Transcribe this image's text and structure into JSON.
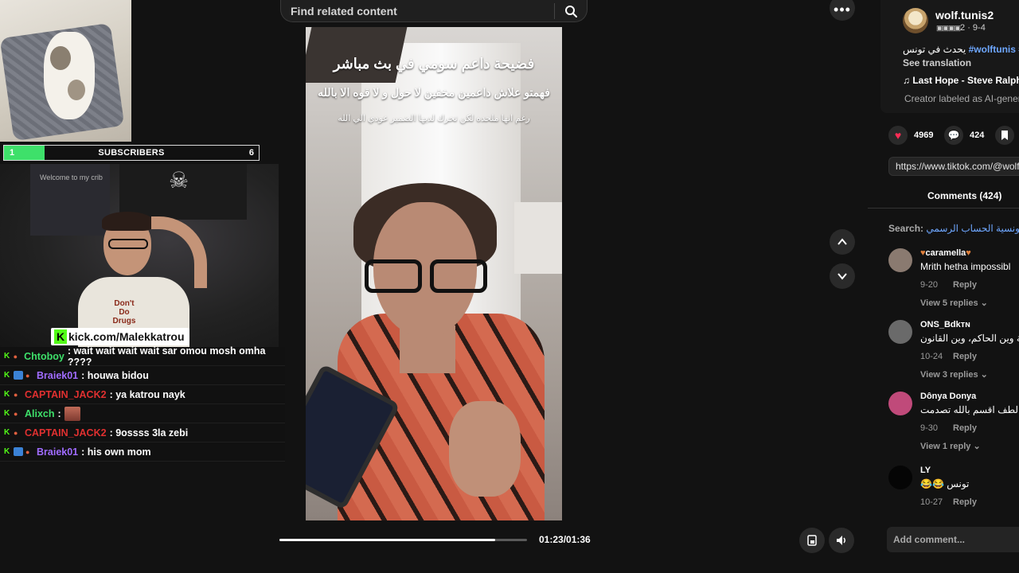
{
  "overlay": {
    "subscribers_label": "SUBSCRIBERS",
    "subscribers_current": "1",
    "subscribers_goal": "6",
    "subscribers_progress": 0.16,
    "cam_welcome": "Welcome to my crib",
    "shirt_text": "Don't Do Drugs",
    "kick_url": "kick.com/Malekkatrou"
  },
  "chat": [
    {
      "user": "Chtoboy",
      "message": ": wait wait wait wait sar omou mosh omha ????",
      "color": "#3ee06a"
    },
    {
      "user": "Braiek01",
      "message": ": houwa bidou",
      "color": "#a06cff"
    },
    {
      "user": "CAPTAIN_JACK2",
      "message": ": ya katrou nayk",
      "color": "#e03030"
    },
    {
      "user": "Alixch",
      "message": ":",
      "color": "#3ee06a",
      "emote": true
    },
    {
      "user": "CAPTAIN_JACK2",
      "message": ": 9ossss 3la zebi",
      "color": "#e03030"
    },
    {
      "user": "Braiek01",
      "message": ": his own mom",
      "color": "#a06cff"
    }
  ],
  "player": {
    "search_placeholder": "Find related content",
    "caption_1": "فضيحة داعم سومي في بث مباشر",
    "caption_2": "فهمتو علاش داعمين مخفين لا حول و لا قوه الا بالله",
    "caption_3": "رغم انها ملحده لكن تحرك لديها الضمير عودي الي الله",
    "time": "01:23/01:36",
    "progress": 0.87
  },
  "post": {
    "username": "wolf.tunis2",
    "date": "2 · 9-4",
    "description_text": "يحدث في تونس",
    "hashtags": "#wolftunis #bas",
    "see_translation": "See translation",
    "music": "Last Hope - Steve Ralph",
    "ai_label": "Creator labeled as AI-generated",
    "likes": "4969",
    "comments_count": "424",
    "url": "https://www.tiktok.com/@wolf",
    "comments_tab": "Comments (424)",
    "search_label": "Search:",
    "search_value": "التونسية الحساب الرسمي"
  },
  "comments": [
    {
      "name": "caramella",
      "text": "Mrith hetha impossibl",
      "date": "9-20",
      "reply": "Reply",
      "view_replies": "View 5 replies"
    },
    {
      "name": "ONS_Bdkᴛɴ",
      "text": "الدولة وين الحاكم، وين القانون",
      "date": "10-24",
      "reply": "Reply",
      "view_replies": "View 3 replies"
    },
    {
      "name": "Dônya Donya",
      "text": "يا ربي لطف اقسم بالله تصدمت",
      "date": "9-30",
      "reply": "Reply",
      "view_replies": "View 1 reply"
    },
    {
      "name": "LY",
      "text": "😂😂 تونس",
      "date": "10-27",
      "reply": "Reply",
      "view_replies": ""
    }
  ],
  "add_comment_placeholder": "Add comment..."
}
